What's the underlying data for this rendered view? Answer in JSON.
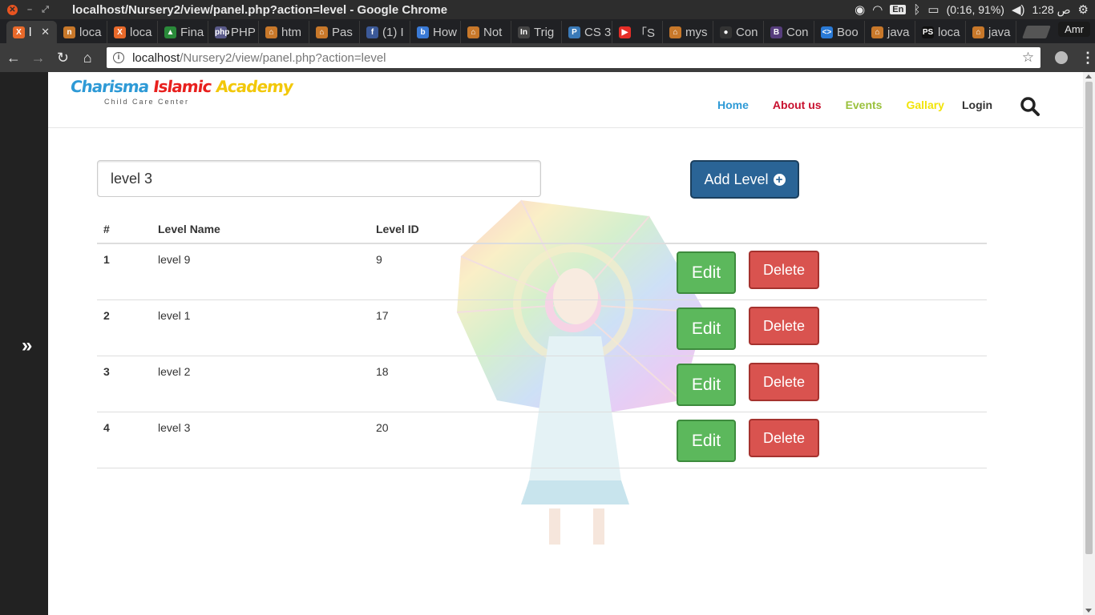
{
  "os": {
    "window_title": "localhost/Nursery2/view/panel.php?action=level - Google Chrome",
    "lang": "En",
    "battery": "(0:16, 91%)",
    "clock": "1:28 ص"
  },
  "browser": {
    "tabs": [
      {
        "label": "l",
        "fav_color": "#e8692a",
        "fav_text": "X"
      },
      {
        "label": "loca",
        "fav_color": "#c8782a",
        "fav_text": "n"
      },
      {
        "label": "loca",
        "fav_color": "#e8692a",
        "fav_text": "X"
      },
      {
        "label": "Fina",
        "fav_color": "#2a8a3a",
        "fav_text": "▲"
      },
      {
        "label": "PHP",
        "fav_color": "#5a5a8a",
        "fav_text": "php"
      },
      {
        "label": "htm",
        "fav_color": "#c8782a",
        "fav_text": "⌂"
      },
      {
        "label": "Pas",
        "fav_color": "#c8782a",
        "fav_text": "⌂"
      },
      {
        "label": "(1) I",
        "fav_color": "#3b5998",
        "fav_text": "f"
      },
      {
        "label": "How",
        "fav_color": "#3a7ad6",
        "fav_text": "b"
      },
      {
        "label": "Not",
        "fav_color": "#c8782a",
        "fav_text": "⌂"
      },
      {
        "label": "Trig",
        "fav_color": "#444",
        "fav_text": "In"
      },
      {
        "label": "CS 3",
        "fav_color": "#3a7ab8",
        "fav_text": "P"
      },
      {
        "label": "「S",
        "fav_color": "#e52d27",
        "fav_text": "▶"
      },
      {
        "label": "mys",
        "fav_color": "#c8782a",
        "fav_text": "⌂"
      },
      {
        "label": "Con",
        "fav_color": "#333",
        "fav_text": "●"
      },
      {
        "label": "Con",
        "fav_color": "#563d7c",
        "fav_text": "B"
      },
      {
        "label": "Boo",
        "fav_color": "#2a7ad6",
        "fav_text": "<>"
      },
      {
        "label": "java",
        "fav_color": "#c8782a",
        "fav_text": "⌂"
      },
      {
        "label": "loca",
        "fav_color": "#111",
        "fav_text": "PS"
      },
      {
        "label": "java",
        "fav_color": "#c8782a",
        "fav_text": "⌂"
      }
    ],
    "profile": "Amr",
    "url_host": "localhost",
    "url_path": "/Nursery2/view/panel.php?action=level"
  },
  "site": {
    "logo_text": "Charisma Islamic Academy",
    "logo_sub": "Child Care Center",
    "nav": {
      "home": "Home",
      "about": "About us",
      "events": "Events",
      "gallary": "Gallary",
      "login": "Login"
    }
  },
  "form": {
    "level_value": "level 3",
    "add_label": "Add Level"
  },
  "table": {
    "headers": [
      "#",
      "Level Name",
      "Level ID"
    ],
    "rows": [
      {
        "num": "1",
        "name": "level 9",
        "id": "9"
      },
      {
        "num": "2",
        "name": "level 1",
        "id": "17"
      },
      {
        "num": "3",
        "name": "level 2",
        "id": "18"
      },
      {
        "num": "4",
        "name": "level 3",
        "id": "20"
      }
    ],
    "edit_label": "Edit",
    "delete_label": "Delete"
  }
}
